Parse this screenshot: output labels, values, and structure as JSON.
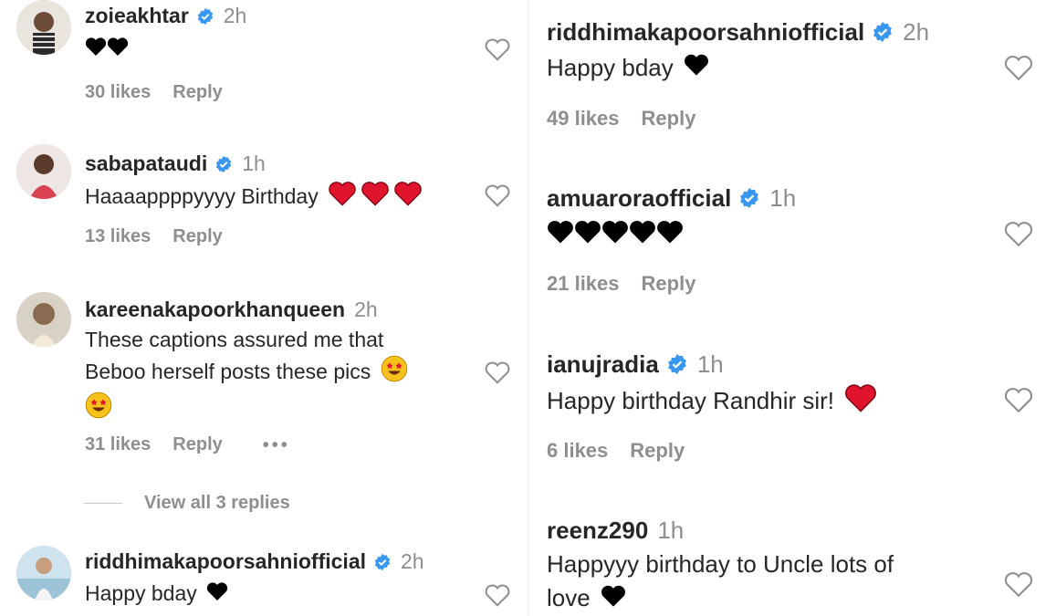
{
  "left_comments": [
    {
      "username": "zoieakhtar",
      "verified": true,
      "time": "2h",
      "text": "",
      "hearts": 2,
      "heart_color": "#000000",
      "likes": "30 likes",
      "reply": "Reply"
    },
    {
      "username": "sabapataudi",
      "verified": true,
      "time": "1h",
      "text": "Haaaappppyyyy Birthday",
      "hearts": 3,
      "heart_color": "#e0152d",
      "likes": "13 likes",
      "reply": "Reply"
    },
    {
      "username": "kareenakapoorkhanqueen",
      "verified": false,
      "time": "2h",
      "text_line1": "These captions assured me that",
      "text_line2": "Beboo herself posts these pics",
      "likes": "31 likes",
      "reply": "Reply",
      "more": "•••",
      "view_replies": "View all 3 replies"
    },
    {
      "username": "riddhimakapoorsahniofficial",
      "verified": true,
      "time": "2h",
      "text": "Happy bday",
      "hearts": 1,
      "heart_color": "#000000"
    }
  ],
  "right_comments": [
    {
      "username": "riddhimakapoorsahniofficial",
      "verified": true,
      "time": "2h",
      "text": "Happy bday",
      "hearts": 1,
      "heart_color": "#000000",
      "likes": "49 likes",
      "reply": "Reply"
    },
    {
      "username": "amuaroraofficial",
      "verified": true,
      "time": "1h",
      "text": "",
      "hearts": 5,
      "heart_color": "#000000",
      "likes": "21 likes",
      "reply": "Reply"
    },
    {
      "username": "ianujradia",
      "verified": true,
      "time": "1h",
      "text": "Happy birthday Randhir sir!",
      "hearts": 1,
      "heart_color": "#e0152d",
      "likes": "6 likes",
      "reply": "Reply"
    },
    {
      "username": "reenz290",
      "verified": false,
      "time": "1h",
      "text_line1": "Happyyy birthday to Uncle lots of",
      "text_line2": "love",
      "hearts": 1,
      "heart_color": "#000000"
    }
  ],
  "colors": {
    "verified_blue": "#3897f0",
    "secondary_text": "#8e8e8e",
    "primary_text": "#262626"
  },
  "icons": {
    "like": "heart-outline-icon",
    "verified": "verified-badge-icon",
    "emoji": "star-struck-emoji-icon"
  }
}
